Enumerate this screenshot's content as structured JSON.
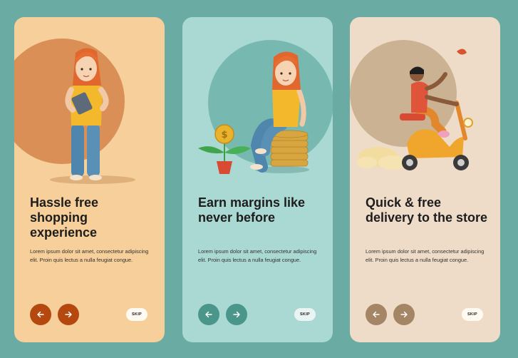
{
  "cards": [
    {
      "title": "Hassle free shopping experience",
      "description": "Lorem ipsum dolor sit amet, consectetur adipiscing elit. Proin quis lectus a nulla feugiat congue.",
      "skip_label": "SKIP",
      "illustration": "woman-with-tablet",
      "accent": "#b5480e",
      "background": "#f6cf9a"
    },
    {
      "title": "Earn margins like never before",
      "description": "Lorem ipsum dolor sit amet, consectetur adipiscing elit. Proin quis lectus a nulla feugiat congue.",
      "skip_label": "SKIP",
      "illustration": "woman-on-coins-with-money-plant",
      "accent": "#4a968b",
      "background": "#aad8d3"
    },
    {
      "title": "Quick & free delivery to the store",
      "description": "Lorem ipsum dolor sit amet, consectetur adipiscing elit. Proin quis lectus a nulla feugiat congue.",
      "skip_label": "SKIP",
      "illustration": "delivery-scooter",
      "accent": "#a48565",
      "background": "#efdcc8"
    }
  ],
  "icons": {
    "prev": "arrow-left-icon",
    "next": "arrow-right-icon"
  }
}
